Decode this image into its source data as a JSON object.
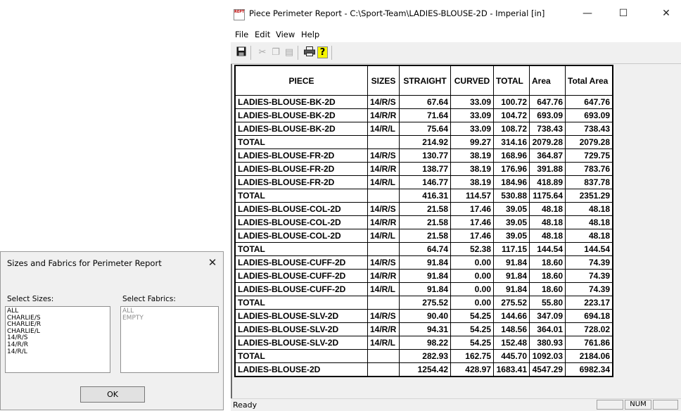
{
  "dialog": {
    "title": "Sizes and Fabrics for Perimeter Report",
    "close_glyph": "✕",
    "sizes_label": "Select Sizes:",
    "fabrics_label": "Select Fabrics:",
    "sizes": [
      "ALL",
      "CHARLIE/S",
      "CHARLIE/R",
      "CHARLIE/L",
      "14/R/S",
      "14/R/R",
      "14/R/L"
    ],
    "fabrics": [
      "ALL",
      "EMPTY"
    ],
    "ok_label": "OK"
  },
  "window": {
    "icon_text": "REPT",
    "title": "Piece Perimeter Report - C:\\Sport-Team\\LADIES-BLOUSE-2D - Imperial [in]",
    "minimize_glyph": "—",
    "maximize_glyph": "☐",
    "close_glyph": "✕"
  },
  "menu": [
    "File",
    "Edit",
    "View",
    "Help"
  ],
  "toolbar": {
    "save_icon": "save-icon",
    "cut_icon": "cut-icon",
    "copy_icon": "copy-icon",
    "paste_icon": "paste-icon",
    "print_icon": "print-icon",
    "help_icon": "help-icon"
  },
  "table": {
    "headers": [
      "PIECE",
      "SIZES",
      "STRAIGHT",
      "CURVED",
      "TOTAL",
      "Area",
      "Total Area"
    ],
    "rows": [
      [
        "LADIES-BLOUSE-BK-2D",
        "14/R/S",
        "67.64",
        "33.09",
        "100.72",
        "647.76",
        "647.76"
      ],
      [
        "LADIES-BLOUSE-BK-2D",
        "14/R/R",
        "71.64",
        "33.09",
        "104.72",
        "693.09",
        "693.09"
      ],
      [
        "LADIES-BLOUSE-BK-2D",
        "14/R/L",
        "75.64",
        "33.09",
        "108.72",
        "738.43",
        "738.43"
      ],
      [
        "TOTAL",
        "",
        "214.92",
        "99.27",
        "314.16",
        "2079.28",
        "2079.28"
      ],
      [
        "LADIES-BLOUSE-FR-2D",
        "14/R/S",
        "130.77",
        "38.19",
        "168.96",
        "364.87",
        "729.75"
      ],
      [
        "LADIES-BLOUSE-FR-2D",
        "14/R/R",
        "138.77",
        "38.19",
        "176.96",
        "391.88",
        "783.76"
      ],
      [
        "LADIES-BLOUSE-FR-2D",
        "14/R/L",
        "146.77",
        "38.19",
        "184.96",
        "418.89",
        "837.78"
      ],
      [
        "TOTAL",
        "",
        "416.31",
        "114.57",
        "530.88",
        "1175.64",
        "2351.29"
      ],
      [
        "LADIES-BLOUSE-COL-2D",
        "14/R/S",
        "21.58",
        "17.46",
        "39.05",
        "48.18",
        "48.18"
      ],
      [
        "LADIES-BLOUSE-COL-2D",
        "14/R/R",
        "21.58",
        "17.46",
        "39.05",
        "48.18",
        "48.18"
      ],
      [
        "LADIES-BLOUSE-COL-2D",
        "14/R/L",
        "21.58",
        "17.46",
        "39.05",
        "48.18",
        "48.18"
      ],
      [
        "TOTAL",
        "",
        "64.74",
        "52.38",
        "117.15",
        "144.54",
        "144.54"
      ],
      [
        "LADIES-BLOUSE-CUFF-2D",
        "14/R/S",
        "91.84",
        "0.00",
        "91.84",
        "18.60",
        "74.39"
      ],
      [
        "LADIES-BLOUSE-CUFF-2D",
        "14/R/R",
        "91.84",
        "0.00",
        "91.84",
        "18.60",
        "74.39"
      ],
      [
        "LADIES-BLOUSE-CUFF-2D",
        "14/R/L",
        "91.84",
        "0.00",
        "91.84",
        "18.60",
        "74.39"
      ],
      [
        "TOTAL",
        "",
        "275.52",
        "0.00",
        "275.52",
        "55.80",
        "223.17"
      ],
      [
        "LADIES-BLOUSE-SLV-2D",
        "14/R/S",
        "90.40",
        "54.25",
        "144.66",
        "347.09",
        "694.18"
      ],
      [
        "LADIES-BLOUSE-SLV-2D",
        "14/R/R",
        "94.31",
        "54.25",
        "148.56",
        "364.01",
        "728.02"
      ],
      [
        "LADIES-BLOUSE-SLV-2D",
        "14/R/L",
        "98.22",
        "54.25",
        "152.48",
        "380.93",
        "761.86"
      ],
      [
        "TOTAL",
        "",
        "282.93",
        "162.75",
        "445.70",
        "1092.03",
        "2184.06"
      ],
      [
        "LADIES-BLOUSE-2D",
        "",
        "1254.42",
        "428.97",
        "1683.41",
        "4547.29",
        "6982.34"
      ]
    ]
  },
  "status": {
    "text": "Ready",
    "num": "NUM"
  }
}
